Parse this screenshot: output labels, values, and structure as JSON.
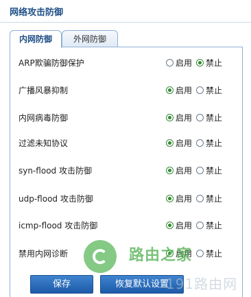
{
  "header": {
    "title": "网络攻击防御"
  },
  "tabs": [
    {
      "label": "内网防御",
      "active": true
    },
    {
      "label": "外网防御",
      "active": false
    }
  ],
  "options": {
    "enable": "启用",
    "disable": "禁止"
  },
  "rows": [
    {
      "label": "ARP欺骗防御保护",
      "selected": "disable"
    },
    {
      "label": "广播风暴抑制",
      "selected": "enable"
    },
    {
      "label": "内网病毒防御",
      "selected": "enable"
    },
    {
      "label": "过滤未知协议",
      "selected": "enable"
    },
    {
      "label": "syn-flood 攻击防御",
      "selected": "enable"
    },
    {
      "label": "udp-flood 攻击防御",
      "selected": "enable"
    },
    {
      "label": "icmp-flood 攻击防御",
      "selected": "enable"
    },
    {
      "label": "禁用内网诊断",
      "selected": "enable"
    }
  ],
  "buttons": {
    "save": "保存",
    "restore": "恢复默认设置"
  },
  "watermark": {
    "brand": "路由之家",
    "site": "191路由网"
  },
  "colors": {
    "accent": "#1f4f86",
    "button": "#2a6dbd",
    "radio_checked": "#2f8a2f"
  }
}
